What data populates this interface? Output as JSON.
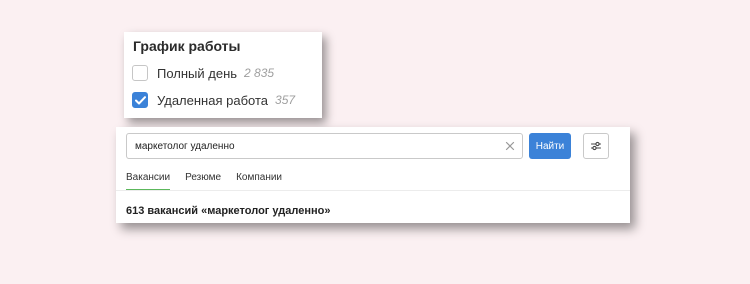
{
  "filter": {
    "title": "График работы",
    "options": [
      {
        "label": "Полный день",
        "count": "2 835",
        "checked": false
      },
      {
        "label": "Удаленная работа",
        "count": "357",
        "checked": true
      }
    ]
  },
  "search": {
    "value": "маркетолог удаленно",
    "button_label": "Найти",
    "clear_icon": "close-icon",
    "filters_icon": "sliders-icon"
  },
  "tabs": [
    {
      "label": "Вакансии",
      "active": true
    },
    {
      "label": "Резюме",
      "active": false
    },
    {
      "label": "Компании",
      "active": false
    }
  ],
  "results": {
    "title": "613 вакансий «маркетолог удаленно»"
  },
  "colors": {
    "background": "#fbf0f2",
    "accent": "#3b82d8",
    "active_tab_underline": "#5cb85c"
  }
}
